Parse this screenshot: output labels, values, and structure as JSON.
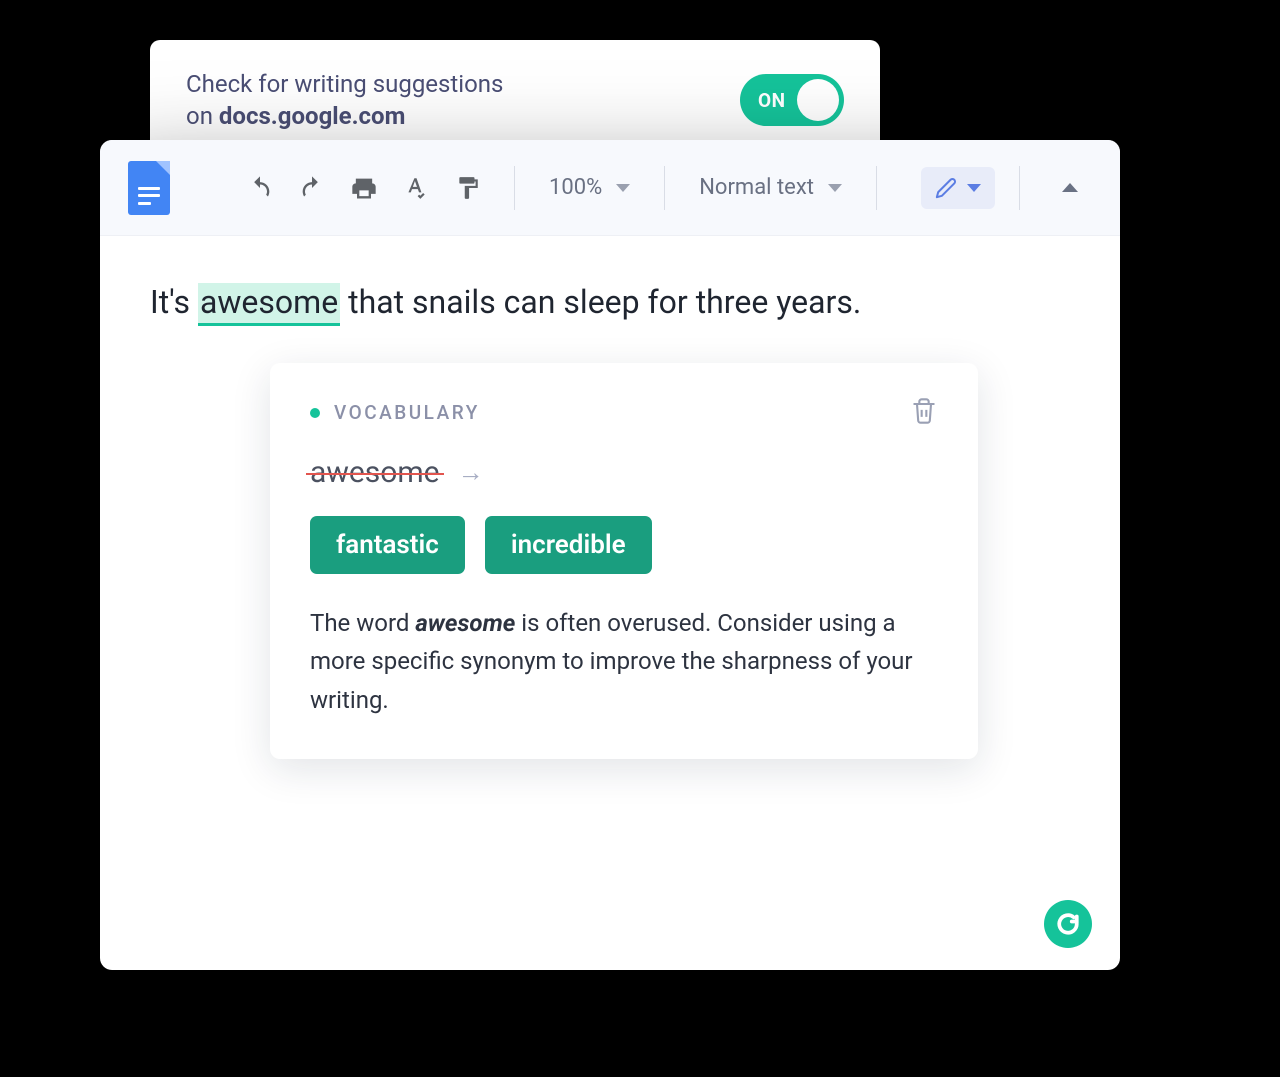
{
  "settings": {
    "line1": "Check for writing suggestions",
    "line2_prefix": "on ",
    "domain": "docs.google.com",
    "toggle_label": "ON"
  },
  "toolbar": {
    "zoom": "100%",
    "style": "Normal text"
  },
  "document": {
    "sentence_before": "It's ",
    "highlighted_word": "awesome",
    "sentence_after": " that snails can sleep for three years."
  },
  "suggestion": {
    "category": "VOCABULARY",
    "original_word": "awesome",
    "alternatives": [
      "fantastic",
      "incredible"
    ],
    "explanation_pre": "The word ",
    "explanation_word": "awesome",
    "explanation_post": " is often overused. Consider using a more specific synonym to improve the sharpness of your writing."
  },
  "colors": {
    "accent": "#15c39a"
  }
}
